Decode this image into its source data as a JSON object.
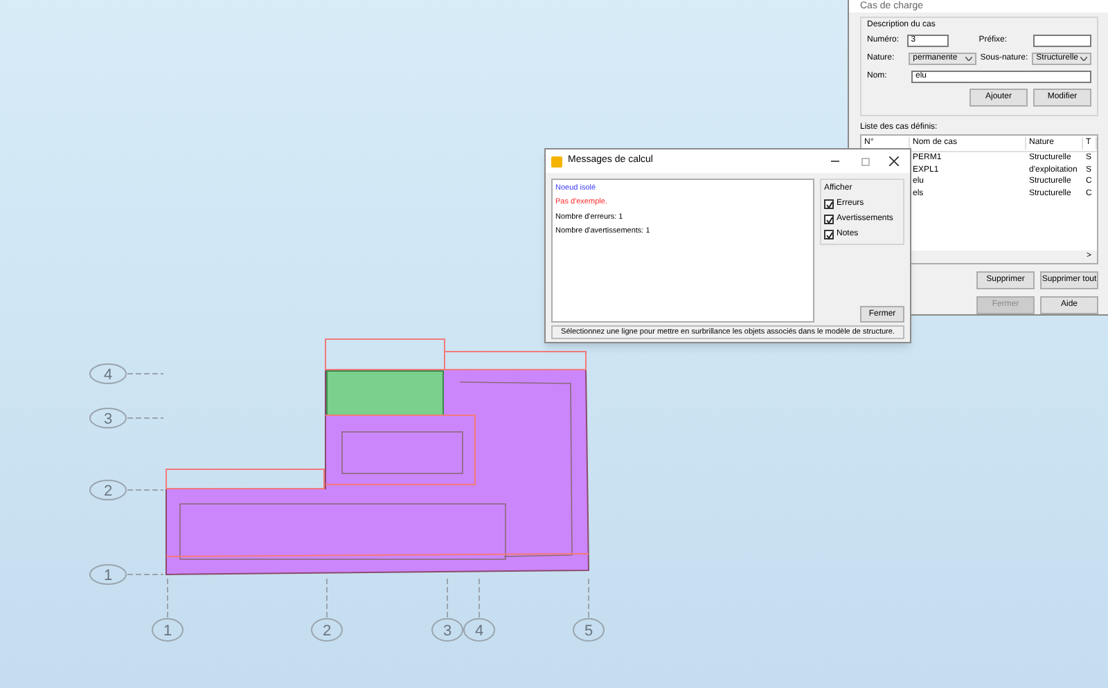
{
  "grid_rows": [
    {
      "label": "4"
    },
    {
      "label": "3"
    },
    {
      "label": "2"
    },
    {
      "label": "1"
    }
  ],
  "grid_columns": [
    {
      "label": "1"
    },
    {
      "label": "2"
    },
    {
      "label": "3"
    },
    {
      "label": "4"
    },
    {
      "label": "5"
    }
  ],
  "load_cases_window": {
    "title": "Cas de charge",
    "description_group": "Description du cas",
    "numero_label": "Numéro:",
    "numero_value": "3",
    "prefixe_label": "Préfixe:",
    "nature_label": "Nature:",
    "nature_value": "permanente",
    "sous_nature_label": "Sous-nature:",
    "sous_nature_value": "Structurelle",
    "nom_label": "Nom:",
    "nom_value": "elu",
    "buttons_top": [
      {
        "label": "Ajouter",
        "disabled": false
      },
      {
        "label": "Modifier",
        "disabled": false
      }
    ],
    "list_label": "Liste des cas définis:",
    "table": {
      "columns": [
        "N°",
        "Nom de cas",
        "Nature",
        "T"
      ],
      "rows": [
        [
          "",
          "PERM1",
          "Structurelle",
          "S"
        ],
        [
          "",
          "EXPL1",
          "d'exploitation",
          "S"
        ],
        [
          "",
          "elu",
          "Structurelle",
          "C"
        ],
        [
          "",
          "els",
          "Structurelle",
          "C"
        ]
      ]
    },
    "scroll_arrow": ">",
    "buttons_mid": [
      {
        "label": "Supprimer",
        "disabled": false
      },
      {
        "label": "Supprimer tout",
        "disabled": false
      }
    ],
    "buttons_bottom": [
      {
        "label": "Fermer",
        "disabled": true
      },
      {
        "label": "Aide",
        "disabled": false
      }
    ]
  },
  "messages_window": {
    "title": "Messages de calcul",
    "messages": [
      {
        "text": "Noeud isolé",
        "color": "#3b3bff"
      },
      {
        "text": "Pas d'exemple.",
        "color": "#ff2a2a"
      },
      {
        "text": "Nombre d'erreurs: 1",
        "color": "#000000"
      },
      {
        "text": "Nombre d'avertissements: 1",
        "color": "#000000"
      }
    ],
    "filter_group": "Afficher",
    "filters": [
      {
        "label": "Erreurs",
        "checked": true
      },
      {
        "label": "Avertissements",
        "checked": true
      },
      {
        "label": "Notes",
        "checked": true
      }
    ],
    "close_button": "Fermer",
    "status": "Sélectionnez une ligne pour mettre en surbrillance les objets associés dans le modèle de structure."
  }
}
